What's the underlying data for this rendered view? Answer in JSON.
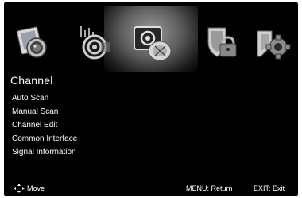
{
  "icon_bar": {
    "icons": [
      {
        "name": "picture-icon"
      },
      {
        "name": "sound-icon"
      },
      {
        "name": "channel-icon",
        "selected": true
      },
      {
        "name": "lock-icon"
      },
      {
        "name": "setup-icon"
      }
    ]
  },
  "menu": {
    "title": "Channel",
    "items": [
      {
        "label": "Auto Scan"
      },
      {
        "label": "Manual Scan"
      },
      {
        "label": "Channel Edit"
      },
      {
        "label": "Common Interface"
      },
      {
        "label": "Signal Information"
      }
    ]
  },
  "footer": {
    "move_label": "Move",
    "menu_label": "MENU: Return",
    "exit_label": "EXIT: Exit"
  },
  "colors": {
    "background": "#000000",
    "text": "#ffffff",
    "highlight": "#8a8a8a"
  }
}
